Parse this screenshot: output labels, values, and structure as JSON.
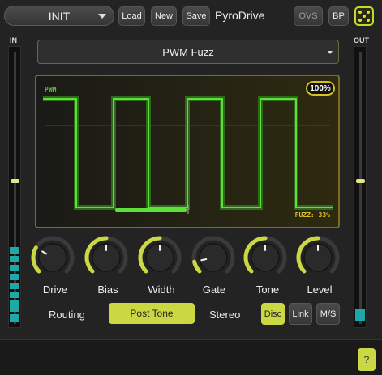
{
  "toolbar": {
    "preset": "INIT",
    "load": "Load",
    "new": "New",
    "save": "Save",
    "title": "PyroDrive",
    "ovs": "OVS",
    "bp": "BP"
  },
  "meters": {
    "in_label": "IN",
    "out_label": "OUT"
  },
  "mode": {
    "selected": "PWM Fuzz"
  },
  "scope": {
    "waveform_label": "PWM",
    "mix_percent": "100%",
    "fuzz_readout": "FUZZ: 33%",
    "pulse_width": 0.33
  },
  "knobs": [
    {
      "label": "Drive",
      "value": 0.28
    },
    {
      "label": "Bias",
      "value": 0.5
    },
    {
      "label": "Width",
      "value": 0.5
    },
    {
      "label": "Gate",
      "value": 0.12
    },
    {
      "label": "Tone",
      "value": 0.5
    },
    {
      "label": "Level",
      "value": 0.5
    }
  ],
  "routing": {
    "label": "Routing",
    "value": "Post Tone"
  },
  "stereo": {
    "label": "Stereo",
    "disc": "Disc",
    "link": "Link",
    "ms": "M/S",
    "selected": "Disc"
  },
  "help": "?",
  "colors": {
    "accent": "#cbd843",
    "wave": "#5de03a",
    "meter": "#1fa8a8",
    "scope_border": "#7d6e1e"
  }
}
